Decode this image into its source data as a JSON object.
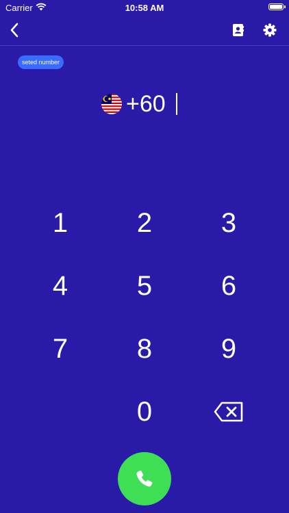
{
  "status_bar": {
    "carrier": "Carrier",
    "time": "10:58 AM"
  },
  "nav": {
    "back_icon": "chevron-left-icon",
    "contacts_icon": "contacts-book-icon",
    "settings_icon": "gear-icon"
  },
  "badge": {
    "label": "seted number"
  },
  "display": {
    "flag": "malaysia-flag",
    "number": "+60"
  },
  "keypad": {
    "keys": [
      {
        "label": "1"
      },
      {
        "label": "2"
      },
      {
        "label": "3"
      },
      {
        "label": "4"
      },
      {
        "label": "5"
      },
      {
        "label": "6"
      },
      {
        "label": "7"
      },
      {
        "label": "8"
      },
      {
        "label": "9"
      },
      {
        "label": "0"
      }
    ],
    "backspace_icon": "backspace-icon"
  },
  "call": {
    "icon": "phone-icon",
    "color": "#3fdf55"
  },
  "colors": {
    "background": "#2a1aa8",
    "badge": "#3a6bff"
  }
}
